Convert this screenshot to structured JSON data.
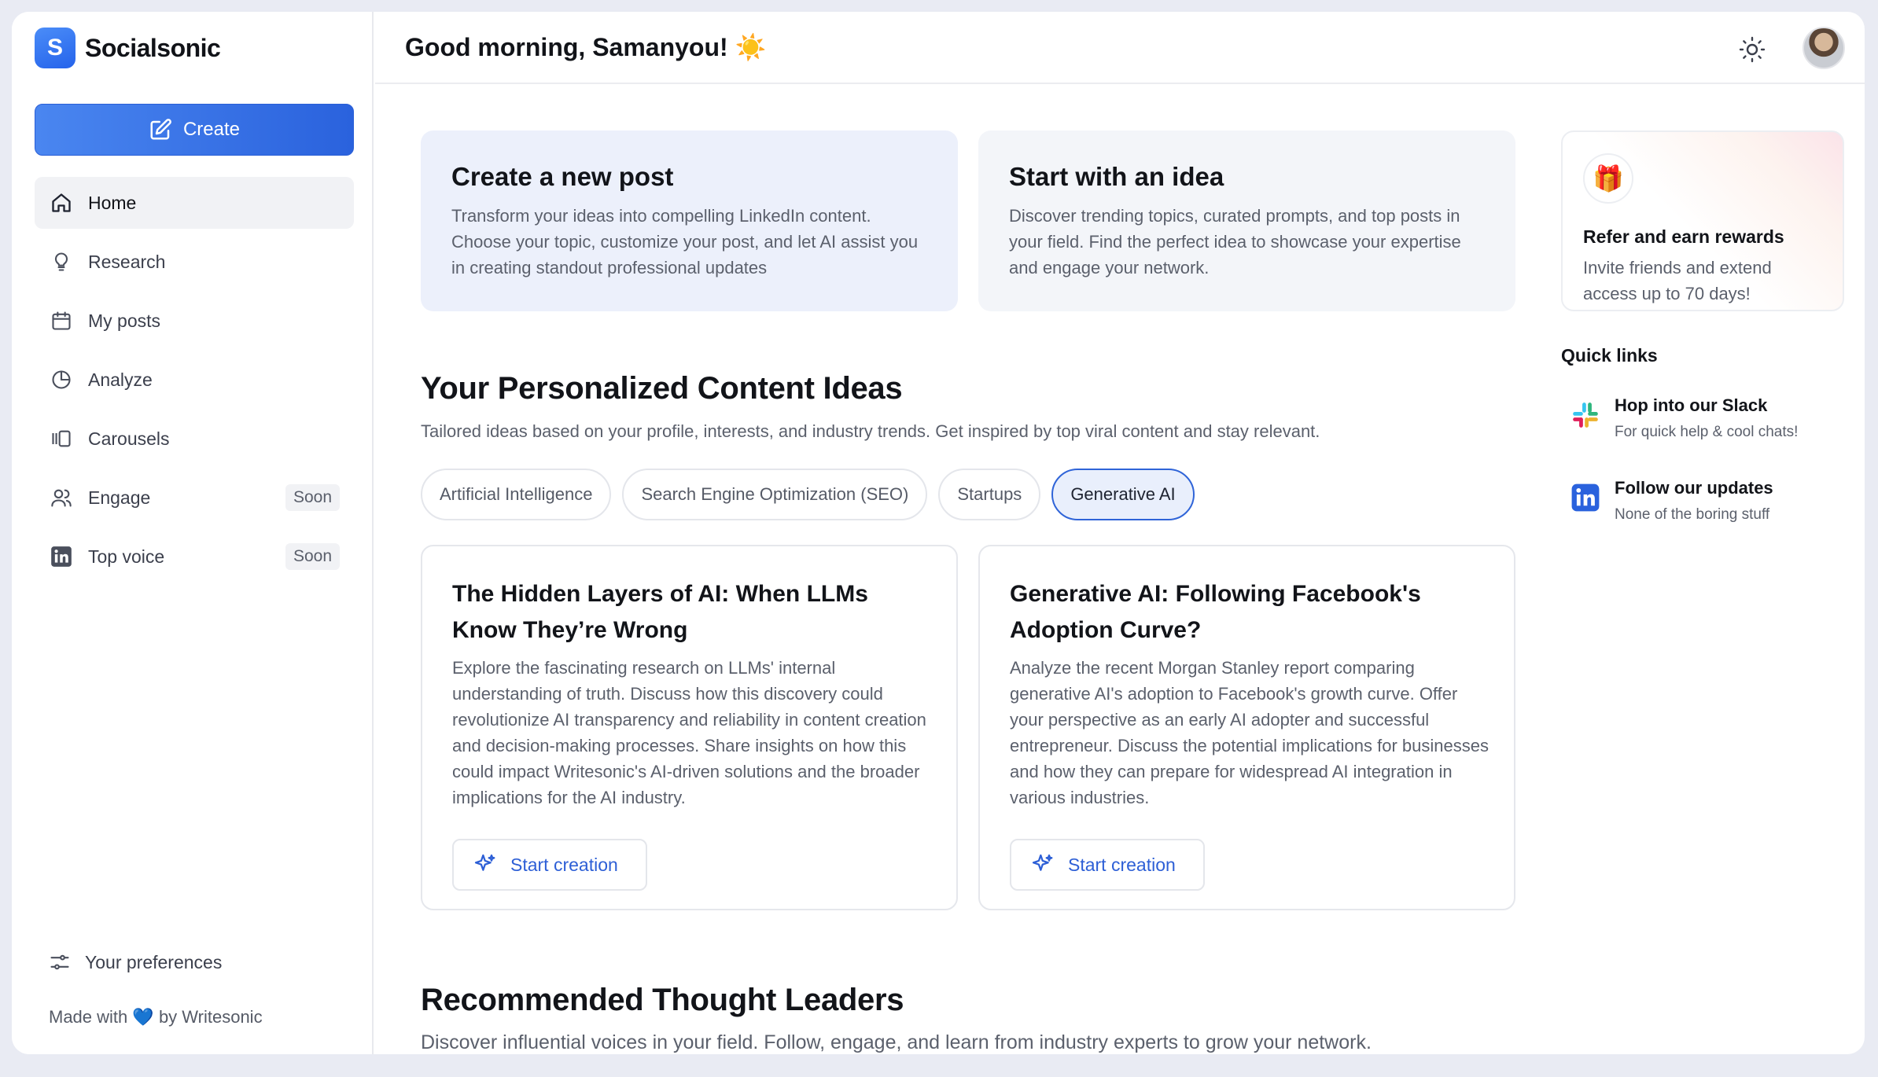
{
  "brand": {
    "name": "Socialsonic",
    "logo_glyph": "S"
  },
  "sidebar": {
    "create_label": "Create",
    "items": [
      {
        "label": "Home",
        "icon": "home-icon",
        "active": true,
        "badge": ""
      },
      {
        "label": "Research",
        "icon": "lightbulb-icon",
        "active": false,
        "badge": ""
      },
      {
        "label": "My posts",
        "icon": "calendar-icon",
        "active": false,
        "badge": ""
      },
      {
        "label": "Analyze",
        "icon": "pie-chart-icon",
        "active": false,
        "badge": ""
      },
      {
        "label": "Carousels",
        "icon": "carousel-icon",
        "active": false,
        "badge": ""
      },
      {
        "label": "Engage",
        "icon": "users-icon",
        "active": false,
        "badge": "Soon"
      },
      {
        "label": "Top voice",
        "icon": "linkedin-icon",
        "active": false,
        "badge": "Soon"
      }
    ],
    "preferences_label": "Your preferences",
    "footer": {
      "made_with": "Made with",
      "heart": "💙",
      "by": "by Writesonic"
    }
  },
  "header": {
    "greeting": "Good morning, Samanyou!",
    "greeting_emoji": "☀️"
  },
  "hero_cards": [
    {
      "title": "Create a new post",
      "description": "Transform your ideas into compelling LinkedIn content. Choose your topic, customize your post, and let AI assist you in creating standout professional updates"
    },
    {
      "title": "Start with an idea",
      "description": "Discover trending topics, curated prompts, and top posts in your field. Find the perfect idea to showcase your expertise and engage your network."
    }
  ],
  "refer": {
    "icon": "🎁",
    "title": "Refer and earn rewards",
    "description": "Invite friends and extend access up to 70 days!"
  },
  "quick_links": {
    "title": "Quick links",
    "items": [
      {
        "title": "Hop into our Slack",
        "subtitle": "For quick help & cool chats!",
        "icon": "slack-icon"
      },
      {
        "title": "Follow our updates",
        "subtitle": "None of the boring stuff",
        "icon": "linkedin-icon"
      }
    ]
  },
  "ideas_section": {
    "title": "Your Personalized Content Ideas",
    "description": "Tailored ideas based on your profile, interests, and industry trends. Get inspired by top viral content and stay relevant.",
    "chips": [
      {
        "label": "Artificial Intelligence",
        "active": false
      },
      {
        "label": "Search Engine Optimization (SEO)",
        "active": false
      },
      {
        "label": "Startups",
        "active": false
      },
      {
        "label": "Generative AI",
        "active": true
      }
    ],
    "cards": [
      {
        "title": "The Hidden Layers of AI: When LLMs Know They’re Wrong",
        "description": "Explore the fascinating research on LLMs' internal understanding of truth. Discuss how this discovery could revolutionize AI transparency and reliability in content creation and decision-making processes. Share insights on how this could impact Writesonic's AI-driven solutions and the broader implications for the AI industry.",
        "button": "Start creation"
      },
      {
        "title": "Generative AI: Following Facebook's Adoption Curve?",
        "description": "Analyze the recent Morgan Stanley report comparing generative AI's adoption to Facebook's growth curve. Offer your perspective as an early AI adopter and successful entrepreneur. Discuss the potential implications for businesses and how they can prepare for widespread AI integration in various industries.",
        "button": "Start creation"
      }
    ]
  },
  "leaders_section": {
    "title": "Recommended Thought Leaders",
    "description": "Discover influential voices in your field. Follow, engage, and learn from industry experts to grow your network."
  },
  "colors": {
    "accent": "#2a62dd",
    "sidebar_active_bg": "#f1f2f5",
    "hero_primary_bg": "#ecf0fb",
    "chip_active_bg": "#e9effc"
  }
}
